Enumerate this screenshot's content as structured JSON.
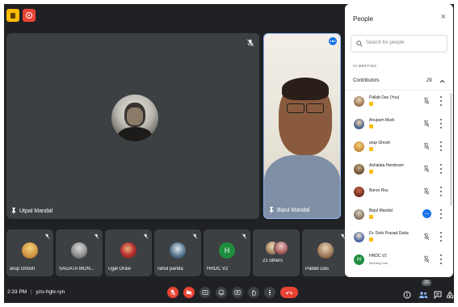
{
  "meeting": {
    "time": "2:33 PM",
    "separator": "|",
    "code": "yzo-hgtv-ryn"
  },
  "main_tiles": [
    {
      "name": "Utpal Mandal"
    },
    {
      "name": "Bipul Mandal"
    }
  ],
  "strip": [
    {
      "name": "arup Ghosh"
    },
    {
      "name": "SAGATA MON..."
    },
    {
      "name": "Ujjal Oraw"
    },
    {
      "name": "rahul panda"
    },
    {
      "name": "HRDC V2",
      "initial": "H"
    },
    {
      "name": "21 others"
    },
    {
      "name": "Pallab Das"
    }
  ],
  "panel": {
    "title": "People",
    "close_glyph": "×",
    "search_placeholder": "Search for people",
    "section_label": "IN MEETING",
    "group_label": "Contributors",
    "group_count": "29",
    "people": [
      {
        "name": "Pallab Das (You)",
        "sub": ""
      },
      {
        "name": "Anupam Mudi",
        "sub": ""
      },
      {
        "name": "arup Ghosh",
        "sub": ""
      },
      {
        "name": "Ashalata Hembram",
        "sub": ""
      },
      {
        "name": "Barun Roy",
        "sub": ""
      },
      {
        "name": "Bipul Mandal",
        "sub": ""
      },
      {
        "name": "Dr. Debi Prasad Datta",
        "sub": ""
      },
      {
        "name": "HRDC V2",
        "sub": "Meeting host",
        "initial": "H"
      }
    ]
  },
  "bottom_right": {
    "people_count": "29"
  },
  "colors": {
    "background": "#202124",
    "tile": "#3c4043",
    "red": "#ea4335",
    "blue": "#1a73e8",
    "yellow": "#fbbc04",
    "green": "#1e8e3e"
  }
}
